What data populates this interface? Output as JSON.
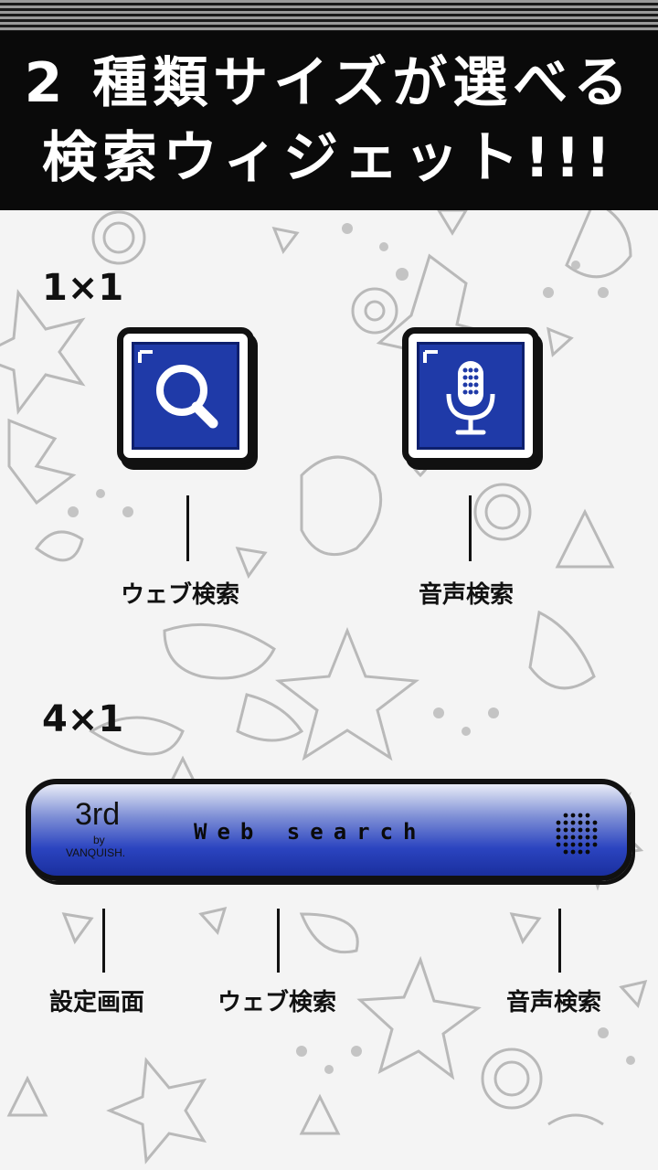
{
  "header": {
    "line1": "2 種類サイズが選べる",
    "line2": "検索ウィジェット!!!"
  },
  "size_1x1": {
    "label": "1×1",
    "web_icon": "search-icon",
    "voice_icon": "microphone-icon",
    "web_caption": "ウェブ検索",
    "voice_caption": "音声検索",
    "accent_color": "#1f3aa8"
  },
  "size_4x1": {
    "label": "4×1",
    "logo_main": "3rd",
    "logo_by": "by",
    "logo_brand": "VANQUISH.",
    "search_text": "Web search",
    "settings_caption": "設定画面",
    "web_caption": "ウェブ検索",
    "voice_caption": "音声検索"
  }
}
